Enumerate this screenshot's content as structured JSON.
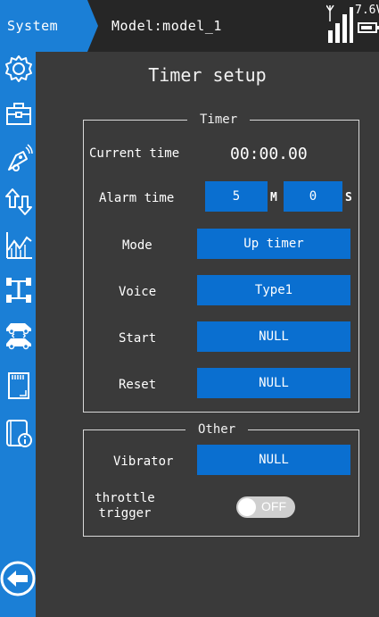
{
  "header": {
    "system_label": "System",
    "model_label": "Model:model_1",
    "voltage": "7.6V"
  },
  "sidebar": {
    "icons": [
      "gear-icon",
      "toolbox-icon",
      "transmitter-icon",
      "updown-arrows-icon",
      "chart-icon",
      "chassis-icon",
      "car-swap-icon",
      "sd-card-icon",
      "info-doc-icon"
    ],
    "back_icon": "back-arrow-icon"
  },
  "page": {
    "title": "Timer setup"
  },
  "timer": {
    "legend": "Timer",
    "current_time_label": "Current time",
    "current_time_value": "00:00.00",
    "alarm_time_label": "Alarm time",
    "alarm_minutes": "5",
    "minutes_unit": "M",
    "alarm_seconds": "0",
    "seconds_unit": "S",
    "mode_label": "Mode",
    "mode_value": "Up timer",
    "voice_label": "Voice",
    "voice_value": "Type1",
    "start_label": "Start",
    "start_value": "NULL",
    "reset_label": "Reset",
    "reset_value": "NULL"
  },
  "other": {
    "legend": "Other",
    "vibrator_label": "Vibrator",
    "vibrator_value": "NULL",
    "throttle_label_line1": "throttle",
    "throttle_label_line2": "trigger",
    "throttle_toggle": "OFF"
  },
  "colors": {
    "accent": "#1b7fd6",
    "button": "#0a6fd0",
    "background": "#3a3a3a",
    "topbar": "#262626"
  }
}
